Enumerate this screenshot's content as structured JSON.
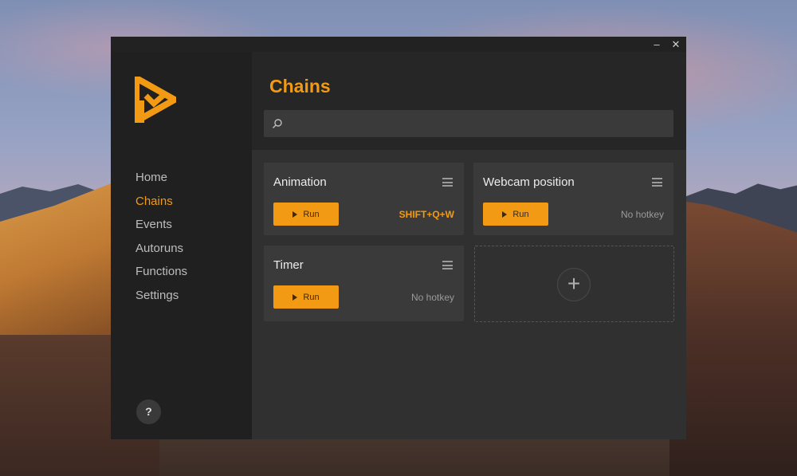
{
  "window": {
    "minimize_glyph": "–",
    "close_glyph": "✕"
  },
  "app": {
    "logo_icon": "triangle-play-logo",
    "accent_color": "#f39a14"
  },
  "sidebar": {
    "items": [
      {
        "label": "Home",
        "active": false
      },
      {
        "label": "Chains",
        "active": true
      },
      {
        "label": "Events",
        "active": false
      },
      {
        "label": "Autoruns",
        "active": false
      },
      {
        "label": "Functions",
        "active": false
      },
      {
        "label": "Settings",
        "active": false
      }
    ],
    "help_label": "?"
  },
  "main": {
    "title": "Chains",
    "search": {
      "placeholder": "",
      "value": ""
    },
    "run_label": "Run",
    "chains": [
      {
        "name": "Animation",
        "hotkey": "SHIFT+Q+W",
        "hotkey_set": true
      },
      {
        "name": "Webcam position",
        "hotkey": "No hotkey",
        "hotkey_set": false
      },
      {
        "name": "Timer",
        "hotkey": "No hotkey",
        "hotkey_set": false
      }
    ],
    "add_label": "+"
  }
}
